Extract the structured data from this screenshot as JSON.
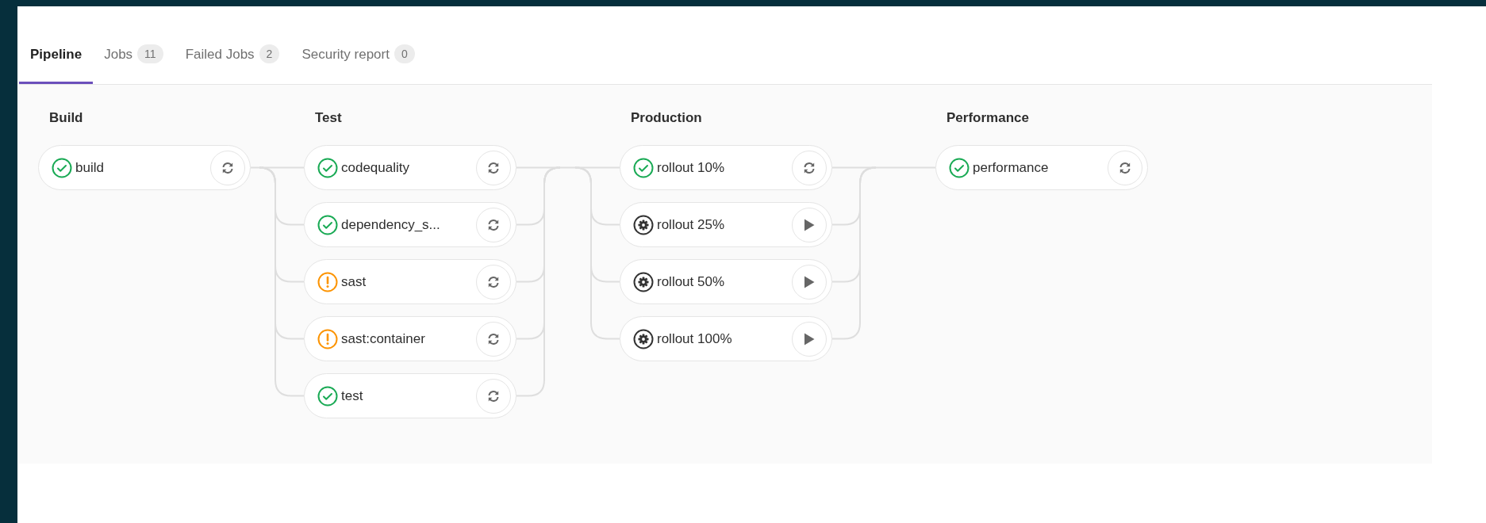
{
  "tabs": [
    {
      "label": "Pipeline",
      "selected": true
    },
    {
      "label": "Jobs",
      "count": "11",
      "selected": false
    },
    {
      "label": "Failed Jobs",
      "count": "2",
      "selected": false
    },
    {
      "label": "Security report",
      "count": "0",
      "selected": false
    }
  ],
  "stages": [
    {
      "name": "Build",
      "jobs": [
        {
          "name": "build",
          "kind": "success",
          "action": {
            "kind": "retry"
          }
        }
      ]
    },
    {
      "name": "Test",
      "jobs": [
        {
          "name": "codequality",
          "kind": "success",
          "action": {
            "kind": "retry"
          }
        },
        {
          "name": "dependency_s...",
          "kind": "success",
          "action": {
            "kind": "retry"
          }
        },
        {
          "name": "sast",
          "kind": "warning",
          "action": {
            "kind": "retry"
          }
        },
        {
          "name": "sast:container",
          "kind": "warning",
          "action": {
            "kind": "retry"
          }
        },
        {
          "name": "test",
          "kind": "success",
          "action": {
            "kind": "retry"
          }
        }
      ]
    },
    {
      "name": "Production",
      "jobs": [
        {
          "name": "rollout 10%",
          "kind": "success",
          "action": {
            "kind": "retry"
          }
        },
        {
          "name": "rollout 25%",
          "kind": "manual",
          "action": {
            "kind": "play"
          }
        },
        {
          "name": "rollout 50%",
          "kind": "manual",
          "action": {
            "kind": "play"
          }
        },
        {
          "name": "rollout 100%",
          "kind": "manual",
          "action": {
            "kind": "play"
          }
        }
      ]
    },
    {
      "name": "Performance",
      "jobs": [
        {
          "name": "performance",
          "kind": "success",
          "action": {
            "kind": "retry"
          }
        }
      ]
    }
  ]
}
